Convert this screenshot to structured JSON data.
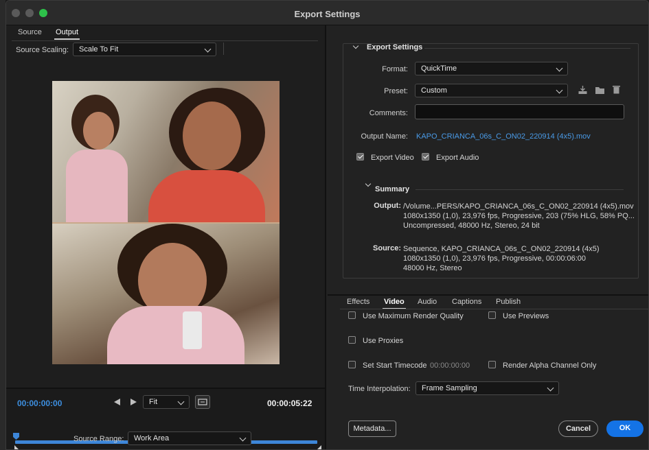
{
  "window": {
    "title": "Export Settings"
  },
  "left": {
    "tabs": [
      {
        "label": "Source"
      },
      {
        "label": "Output"
      }
    ],
    "source_scaling_label": "Source Scaling:",
    "source_scaling_value": "Scale To Fit",
    "timecode_current": "00:00:00:00",
    "timecode_duration": "00:00:05:22",
    "fit_value": "Fit",
    "source_range_label": "Source Range:",
    "source_range_value": "Work Area",
    "playhead_progress": 0.0
  },
  "export_settings": {
    "section_title": "Export Settings",
    "format_label": "Format:",
    "format_value": "QuickTime",
    "preset_label": "Preset:",
    "preset_value": "Custom",
    "comments_label": "Comments:",
    "comments_value": "",
    "output_name_label": "Output Name:",
    "output_name_value": "KAPO_CRIANCA_06s_C_ON02_220914 (4x5).mov",
    "export_video_label": "Export Video",
    "export_audio_label": "Export Audio",
    "summary_title": "Summary",
    "summary_output_key": "Output:",
    "summary_output_lines": [
      "/Volume...PERS/KAPO_CRIANCA_06s_C_ON02_220914 (4x5).mov",
      "1080x1350 (1,0), 23,976 fps, Progressive, 203 (75% HLG, 58% PQ...",
      "Uncompressed, 48000 Hz, Stereo, 24 bit"
    ],
    "summary_source_key": "Source:",
    "summary_source_lines": [
      "Sequence, KAPO_CRIANCA_06s_C_ON02_220914 (4x5)",
      "1080x1350 (1,0), 23,976 fps, Progressive, 00:00:06:00",
      "48000 Hz, Stereo"
    ]
  },
  "lower_tabs": [
    {
      "label": "Effects"
    },
    {
      "label": "Video"
    },
    {
      "label": "Audio"
    },
    {
      "label": "Captions"
    },
    {
      "label": "Publish"
    }
  ],
  "options": {
    "max_render_quality": "Use Maximum Render Quality",
    "use_previews": "Use Previews",
    "use_proxies": "Use Proxies",
    "set_start_timecode": "Set Start Timecode",
    "start_timecode_value": "00:00:00:00",
    "render_alpha": "Render Alpha Channel Only",
    "time_interp_label": "Time Interpolation:",
    "time_interp_value": "Frame Sampling"
  },
  "buttons": {
    "metadata": "Metadata...",
    "cancel": "Cancel",
    "ok": "OK"
  },
  "colors": {
    "accent": "#1473e6",
    "timecode": "#3d8fe0",
    "link": "#4a9be8"
  }
}
